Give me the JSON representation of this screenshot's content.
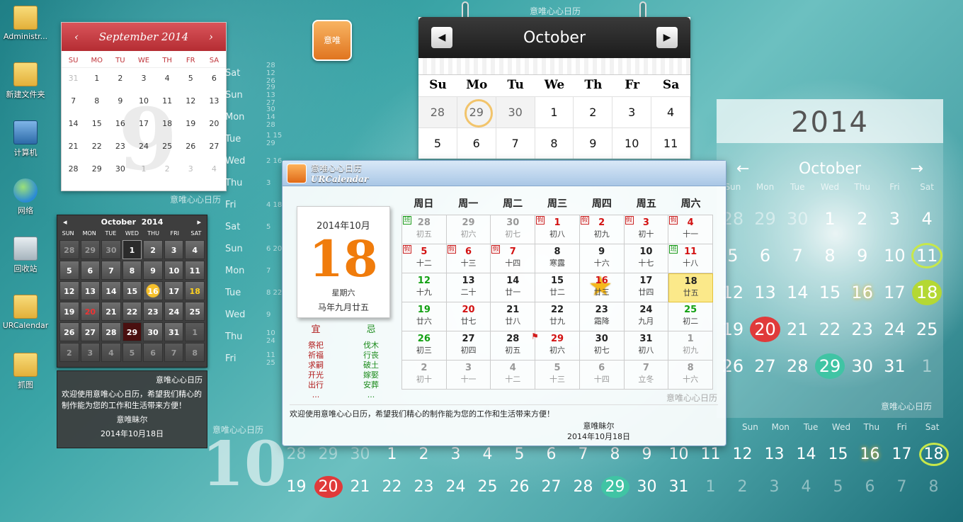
{
  "desktop_icons": [
    "Administr...",
    "新建文件夹",
    "计算机",
    "网络",
    "回收站",
    "URCalendar",
    "抓图"
  ],
  "watermark": "意唯心心日历",
  "shortcut_label": "意唯",
  "sept_widget": {
    "title": "September 2014",
    "prev": "‹",
    "next": "›",
    "dow": [
      "SU",
      "MO",
      "TU",
      "WE",
      "TH",
      "FR",
      "SA"
    ],
    "big_digit": "9",
    "days": [
      {
        "d": "31",
        "dim": true
      },
      {
        "d": "1"
      },
      {
        "d": "2"
      },
      {
        "d": "3"
      },
      {
        "d": "4"
      },
      {
        "d": "5"
      },
      {
        "d": "6"
      },
      {
        "d": "7"
      },
      {
        "d": "8"
      },
      {
        "d": "9"
      },
      {
        "d": "10"
      },
      {
        "d": "11"
      },
      {
        "d": "12"
      },
      {
        "d": "13"
      },
      {
        "d": "14"
      },
      {
        "d": "15"
      },
      {
        "d": "16"
      },
      {
        "d": "17"
      },
      {
        "d": "18"
      },
      {
        "d": "19"
      },
      {
        "d": "20"
      },
      {
        "d": "21"
      },
      {
        "d": "22"
      },
      {
        "d": "23"
      },
      {
        "d": "24"
      },
      {
        "d": "25"
      },
      {
        "d": "26"
      },
      {
        "d": "27"
      },
      {
        "d": "28"
      },
      {
        "d": "29"
      },
      {
        "d": "30"
      },
      {
        "d": "1",
        "dim": true
      },
      {
        "d": "2",
        "dim": true
      },
      {
        "d": "3",
        "dim": true
      },
      {
        "d": "4",
        "dim": true
      }
    ]
  },
  "vertical_list": [
    {
      "w": "Sat",
      "n": "28 12 26"
    },
    {
      "w": "Sun",
      "n": "29 13 27"
    },
    {
      "w": "Mon",
      "n": "30 14 28"
    },
    {
      "w": "Tue",
      "n": "1  15 29"
    },
    {
      "w": "Wed",
      "n": "2 16"
    },
    {
      "w": "Thu",
      "n": "3"
    },
    {
      "w": "Fri",
      "n": "4 18"
    },
    {
      "w": "Sat",
      "n": "5"
    },
    {
      "w": "Sun",
      "n": "6 20"
    },
    {
      "w": "Mon",
      "n": "7"
    },
    {
      "w": "Tue",
      "n": "8 22"
    },
    {
      "w": "Wed",
      "n": "9"
    },
    {
      "w": "Thu",
      "n": "10 24"
    },
    {
      "w": "Fri",
      "n": "11 25"
    }
  ],
  "dark_widget": {
    "title_month": "October",
    "title_year": "2014",
    "prev": "◂",
    "next": "▸",
    "dow": [
      "SUN",
      "MON",
      "TUE",
      "WED",
      "THU",
      "FRI",
      "SAT"
    ],
    "days": [
      {
        "d": "28",
        "dim": true
      },
      {
        "d": "29",
        "dim": true
      },
      {
        "d": "30",
        "dim": true
      },
      {
        "d": "1",
        "sel": true
      },
      {
        "d": "2"
      },
      {
        "d": "3"
      },
      {
        "d": "4"
      },
      {
        "d": "5"
      },
      {
        "d": "6"
      },
      {
        "d": "7"
      },
      {
        "d": "8"
      },
      {
        "d": "9"
      },
      {
        "d": "10"
      },
      {
        "d": "11"
      },
      {
        "d": "12"
      },
      {
        "d": "13"
      },
      {
        "d": "14"
      },
      {
        "d": "15"
      },
      {
        "d": "16",
        "star": true
      },
      {
        "d": "17"
      },
      {
        "d": "18",
        "today": true
      },
      {
        "d": "19"
      },
      {
        "d": "20",
        "red": true
      },
      {
        "d": "21"
      },
      {
        "d": "22"
      },
      {
        "d": "23"
      },
      {
        "d": "24"
      },
      {
        "d": "25"
      },
      {
        "d": "26"
      },
      {
        "d": "27"
      },
      {
        "d": "28"
      },
      {
        "d": "29",
        "flag": true
      },
      {
        "d": "30"
      },
      {
        "d": "31"
      },
      {
        "d": "1",
        "dim": true
      },
      {
        "d": "2",
        "dim": true
      },
      {
        "d": "3",
        "dim": true
      },
      {
        "d": "4",
        "dim": true
      },
      {
        "d": "5",
        "dim": true
      },
      {
        "d": "6",
        "dim": true
      },
      {
        "d": "7",
        "dim": true
      },
      {
        "d": "8",
        "dim": true
      }
    ],
    "note_title": "意唯心心日历",
    "note_text": "欢迎使用意唯心心日历，希望我们精心的制作能为您的工作和生活带来方便！",
    "note_sig": "意唯眛尔",
    "note_date": "2014年10月18日"
  },
  "oct_widget": {
    "title": "October",
    "prev": "◀",
    "next": "▶",
    "dow": [
      "Su",
      "Mo",
      "Tu",
      "We",
      "Th",
      "Fr",
      "Sa"
    ],
    "days": [
      {
        "d": "28",
        "dim": true
      },
      {
        "d": "29",
        "dim": true,
        "ring": true
      },
      {
        "d": "30",
        "dim": true
      },
      {
        "d": "1"
      },
      {
        "d": "2"
      },
      {
        "d": "3"
      },
      {
        "d": "4"
      },
      {
        "d": "5"
      },
      {
        "d": "6"
      },
      {
        "d": "7"
      },
      {
        "d": "8"
      },
      {
        "d": "9"
      },
      {
        "d": "10"
      },
      {
        "d": "11"
      }
    ]
  },
  "right_widget": {
    "year": "2014",
    "month": "October",
    "prev": "←",
    "next": "→",
    "dow": [
      "Sun",
      "Mon",
      "Tue",
      "Wed",
      "Thu",
      "Fri",
      "Sat"
    ],
    "days": [
      {
        "d": "28",
        "dim": true
      },
      {
        "d": "29",
        "dim": true
      },
      {
        "d": "30",
        "dim": true
      },
      {
        "d": "1"
      },
      {
        "d": "2"
      },
      {
        "d": "3"
      },
      {
        "d": "4"
      },
      {
        "d": "5"
      },
      {
        "d": "6"
      },
      {
        "d": "7"
      },
      {
        "d": "8"
      },
      {
        "d": "9"
      },
      {
        "d": "10"
      },
      {
        "d": "11",
        "style": "ring"
      },
      {
        "d": "12"
      },
      {
        "d": "13"
      },
      {
        "d": "14"
      },
      {
        "d": "15"
      },
      {
        "d": "16",
        "style": "star"
      },
      {
        "d": "17"
      },
      {
        "d": "18",
        "style": "lime"
      },
      {
        "d": "19"
      },
      {
        "d": "20",
        "style": "red-c"
      },
      {
        "d": "21"
      },
      {
        "d": "22"
      },
      {
        "d": "23"
      },
      {
        "d": "24"
      },
      {
        "d": "25"
      },
      {
        "d": "26"
      },
      {
        "d": "27"
      },
      {
        "d": "28"
      },
      {
        "d": "29",
        "style": "grn-c"
      },
      {
        "d": "30"
      },
      {
        "d": "31"
      },
      {
        "d": "1",
        "dim": true
      }
    ]
  },
  "strip": {
    "big": "10",
    "dow": [
      "Sun",
      "Mon",
      "Tue",
      "Wed",
      "Thu",
      "Fri",
      "Sat"
    ],
    "row1": [
      {
        "d": "28",
        "dim": true
      },
      {
        "d": "29",
        "dim": true
      },
      {
        "d": "30",
        "dim": true
      },
      {
        "d": "1"
      },
      {
        "d": "2"
      },
      {
        "d": "3"
      },
      {
        "d": "4"
      },
      {
        "d": "5"
      },
      {
        "d": "6"
      },
      {
        "d": "7"
      },
      {
        "d": "8"
      },
      {
        "d": "9"
      },
      {
        "d": "10"
      },
      {
        "d": "11"
      },
      {
        "d": "12"
      },
      {
        "d": "13"
      },
      {
        "d": "14"
      },
      {
        "d": "15"
      },
      {
        "d": "16",
        "style": "star"
      },
      {
        "d": "17"
      },
      {
        "d": "18",
        "style": "ring"
      }
    ],
    "row2": [
      {
        "d": "19"
      },
      {
        "d": "20",
        "style": "red-c"
      },
      {
        "d": "21"
      },
      {
        "d": "22"
      },
      {
        "d": "23"
      },
      {
        "d": "24"
      },
      {
        "d": "25"
      },
      {
        "d": "26"
      },
      {
        "d": "27"
      },
      {
        "d": "28"
      },
      {
        "d": "29",
        "style": "grn-c"
      },
      {
        "d": "30"
      },
      {
        "d": "31"
      },
      {
        "d": "1",
        "dim": true
      },
      {
        "d": "2",
        "dim": true
      },
      {
        "d": "3",
        "dim": true
      },
      {
        "d": "4",
        "dim": true
      },
      {
        "d": "5",
        "dim": true
      },
      {
        "d": "6",
        "dim": true
      },
      {
        "d": "7",
        "dim": true
      },
      {
        "d": "8",
        "dim": true
      }
    ]
  },
  "main_window": {
    "title_cn": "意唯心心日历",
    "title_en": "URCalendar",
    "tear_ym": "2014年10月",
    "tear_day": "18",
    "tear_week": "星期六",
    "tear_lunar": "马年九月廿五",
    "yi_title": "宜",
    "ji_title": "忌",
    "yi": [
      "祭祀",
      "祈福",
      "求嗣",
      "开光",
      "出行",
      "..."
    ],
    "ji": [
      "伐木",
      "行丧",
      "破土",
      "嫁娶",
      "安葬",
      "..."
    ],
    "dow": [
      "周日",
      "周一",
      "周二",
      "周三",
      "周四",
      "周五",
      "周六"
    ],
    "cells": [
      {
        "d": "28",
        "l": "初五",
        "dim": true,
        "tag": "班",
        "tagType": "ban"
      },
      {
        "d": "29",
        "l": "初六",
        "dim": true
      },
      {
        "d": "30",
        "l": "初七",
        "dim": true
      },
      {
        "d": "1",
        "l": "初八",
        "hol": true,
        "tag": "假"
      },
      {
        "d": "2",
        "l": "初九",
        "hol": true,
        "tag": "假"
      },
      {
        "d": "3",
        "l": "初十",
        "hol": true,
        "tag": "假"
      },
      {
        "d": "4",
        "l": "十一",
        "hol": true,
        "tag": "假"
      },
      {
        "d": "5",
        "l": "十二",
        "hol": true,
        "tag": "假"
      },
      {
        "d": "6",
        "l": "十三",
        "hol": true,
        "tag": "假"
      },
      {
        "d": "7",
        "l": "十四",
        "hol": true,
        "tag": "假"
      },
      {
        "d": "8",
        "l": "寒露"
      },
      {
        "d": "9",
        "l": "十六"
      },
      {
        "d": "10",
        "l": "十七"
      },
      {
        "d": "11",
        "l": "十八",
        "hol": true,
        "tag": "班",
        "tagType": "ban"
      },
      {
        "d": "12",
        "l": "十九",
        "wk": true
      },
      {
        "d": "13",
        "l": "二十"
      },
      {
        "d": "14",
        "l": "廿一"
      },
      {
        "d": "15",
        "l": "廿二"
      },
      {
        "d": "16",
        "l": "廿三",
        "hol": true,
        "star": true
      },
      {
        "d": "17",
        "l": "廿四"
      },
      {
        "d": "18",
        "l": "廿五",
        "sel": true
      },
      {
        "d": "19",
        "l": "廿六",
        "wk": true
      },
      {
        "d": "20",
        "l": "廿七",
        "hol": true
      },
      {
        "d": "21",
        "l": "廿八"
      },
      {
        "d": "22",
        "l": "廿九"
      },
      {
        "d": "23",
        "l": "霜降"
      },
      {
        "d": "24",
        "l": "九月"
      },
      {
        "d": "25",
        "l": "初二",
        "wk": true
      },
      {
        "d": "26",
        "l": "初三",
        "wk": true
      },
      {
        "d": "27",
        "l": "初四"
      },
      {
        "d": "28",
        "l": "初五"
      },
      {
        "d": "29",
        "l": "初六",
        "hol": true,
        "flag": true
      },
      {
        "d": "30",
        "l": "初七"
      },
      {
        "d": "31",
        "l": "初八"
      },
      {
        "d": "1",
        "l": "初九",
        "dim": true
      },
      {
        "d": "2",
        "l": "初十",
        "dim": true
      },
      {
        "d": "3",
        "l": "十一",
        "dim": true
      },
      {
        "d": "4",
        "l": "十二",
        "dim": true
      },
      {
        "d": "5",
        "l": "十三",
        "dim": true
      },
      {
        "d": "6",
        "l": "十四",
        "dim": true
      },
      {
        "d": "7",
        "l": "立冬",
        "dim": true
      },
      {
        "d": "8",
        "l": "十六",
        "dim": true
      }
    ],
    "msg": "欢迎使用意唯心心日历，希望我们精心的制作能为您的工作和生活带来方便！",
    "sig": "意唯眛尔",
    "sig_date": "2014年10月18日"
  }
}
